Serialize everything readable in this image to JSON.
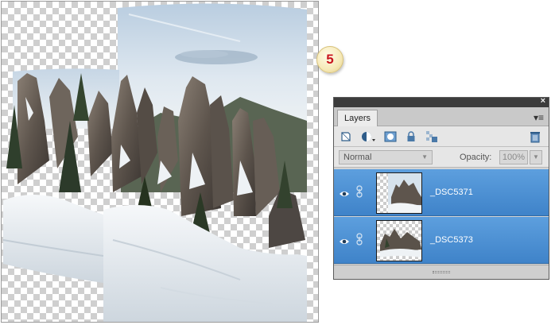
{
  "step_badge": "5",
  "panel": {
    "tab_label": "Layers",
    "close_glyph": "×",
    "menu_glyph": "▾≡",
    "blend_mode": "Normal",
    "opacity_label": "Opacity:",
    "opacity_value": "100%",
    "toolbar_icons": [
      "new-layer-icon",
      "new-adjustment-layer-icon",
      "add-layer-mask-icon",
      "lock-all-icon",
      "lock-transparent-icon",
      "delete-layer-icon"
    ],
    "layers": [
      {
        "name": "_DSC5371",
        "visible": true
      },
      {
        "name": "_DSC5373",
        "visible": true
      }
    ]
  },
  "colors": {
    "layer_selected": "#4a8fd4",
    "badge_text": "#c8141e",
    "panel_title": "#3c3c3c"
  }
}
